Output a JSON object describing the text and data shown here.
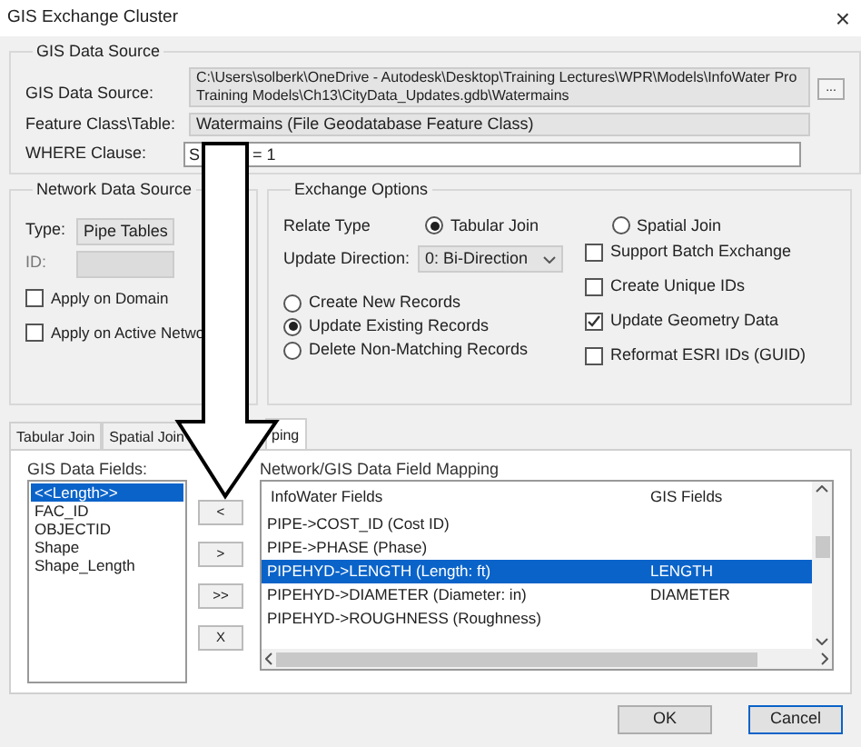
{
  "window": {
    "title": "GIS Exchange Cluster",
    "close": "×"
  },
  "gis_data_source": {
    "title": "GIS Data Source",
    "source_label": "GIS Data Source:",
    "source_value": "C:\\Users\\solberk\\OneDrive - Autodesk\\Desktop\\Training Lectures\\WPR\\Models\\InfoWater Pro Training Models\\Ch13\\CityData_Updates.gdb\\Watermains",
    "browse_button": "...",
    "feature_label": "Feature Class\\Table:",
    "feature_value": "Watermains (File Geodatabase Feature Class)",
    "where_label": "WHERE Clause:",
    "where_value_parts": [
      "S",
      "= 1"
    ]
  },
  "network_data_source": {
    "title": "Network Data Source",
    "type_label": "Type:",
    "type_value": "Pipe Tables",
    "id_label": "ID:",
    "checkboxes": [
      {
        "label": "Apply on Domain",
        "checked": false
      },
      {
        "label": "Apply on Active Netwo",
        "checked": false
      }
    ]
  },
  "exchange_options": {
    "title": "Exchange Options",
    "relate_label": "Relate Type",
    "relate_options": [
      {
        "label": "Tabular Join",
        "selected": true
      },
      {
        "label": "Spatial Join",
        "selected": false
      }
    ],
    "direction_label": "Update Direction:",
    "direction_value": "0: Bi-Direction",
    "record_options": [
      {
        "label": "Create New Records",
        "selected": false
      },
      {
        "label": "Update Existing Records",
        "selected": true
      },
      {
        "label": "Delete Non-Matching Records",
        "selected": false
      }
    ],
    "checkboxes": [
      {
        "label": "Support Batch Exchange",
        "checked": false
      },
      {
        "label": "Create Unique IDs",
        "checked": false
      },
      {
        "label": "Update Geometry Data",
        "checked": true
      },
      {
        "label": "Reformat ESRI IDs (GUID)",
        "checked": false
      }
    ]
  },
  "tabs": [
    {
      "label": "Tabular Join",
      "selected": false
    },
    {
      "label": "Spatial Join",
      "selected": false
    },
    {
      "label": "ping",
      "selected": true
    }
  ],
  "gis_fields": {
    "label": "GIS Data Fields:",
    "items": [
      {
        "label": "<<Length>>",
        "selected": true
      },
      {
        "label": "FAC_ID",
        "selected": false
      },
      {
        "label": "OBJECTID",
        "selected": false
      },
      {
        "label": "Shape",
        "selected": false
      },
      {
        "label": "Shape_Length",
        "selected": false
      }
    ]
  },
  "move_buttons": [
    "<",
    ">",
    ">>",
    "X"
  ],
  "mapping": {
    "label": "Network/GIS Data Field Mapping",
    "columns": [
      "InfoWater Fields",
      "GIS Fields"
    ],
    "rows": [
      {
        "infowater": "PIPE->COST_ID (Cost ID)",
        "gis": "",
        "selected": false
      },
      {
        "infowater": "PIPE->PHASE (Phase)",
        "gis": "",
        "selected": false
      },
      {
        "infowater": "PIPEHYD->LENGTH (Length: ft)",
        "gis": "LENGTH",
        "selected": true
      },
      {
        "infowater": "PIPEHYD->DIAMETER (Diameter: in)",
        "gis": "DIAMETER",
        "selected": false
      },
      {
        "infowater": "PIPEHYD->ROUGHNESS (Roughness)",
        "gis": "",
        "selected": false
      }
    ]
  },
  "buttons": [
    "OK",
    "Cancel"
  ]
}
